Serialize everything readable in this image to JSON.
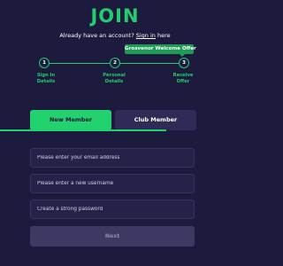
{
  "brand": {
    "title": "JOIN"
  },
  "signin": {
    "prefix": "Already have an account?",
    "link": "Sign in",
    "suffix": "here"
  },
  "offer_badge": {
    "label": "Grosvenor Welcome Offer"
  },
  "steps": [
    {
      "number": "1",
      "label_line1": "Sign In",
      "label_line2": "Details"
    },
    {
      "number": "2",
      "label_line1": "Personal",
      "label_line2": "Details"
    },
    {
      "number": "3",
      "label_line1": "Receive",
      "label_line2": "Offer"
    }
  ],
  "tabs": {
    "new_member": "New Member",
    "club_member": "Club Member"
  },
  "form": {
    "email_placeholder": "Please enter your email address",
    "username_placeholder": "Please enter a new username",
    "password_placeholder": "Create a strong password",
    "next_label": "Next"
  },
  "colors": {
    "background": "#1c1a3d",
    "accent": "#22cc6f",
    "tab_inactive": "#2e2b56",
    "field_background": "#252249",
    "button_disabled": "#3c3963"
  }
}
